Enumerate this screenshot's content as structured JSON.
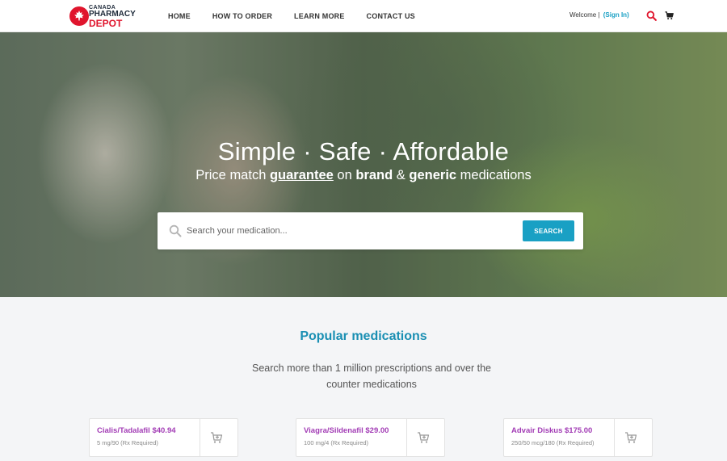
{
  "header": {
    "logo": {
      "line1": "CANADA",
      "line2": "PHARMACY",
      "line3": "DEPOT"
    },
    "nav": [
      {
        "label": "HOME"
      },
      {
        "label": "HOW TO ORDER"
      },
      {
        "label": "LEARN MORE"
      },
      {
        "label": "CONTACT US"
      }
    ],
    "welcome": "Welcome |",
    "signin": "(Sign In)",
    "icons": [
      "search-icon",
      "cart-icon"
    ]
  },
  "hero": {
    "title": "Simple · Safe · Affordable",
    "sub_prefix": "Price match ",
    "sub_guarantee": "guarantee",
    "sub_on": " on ",
    "sub_brand": "brand",
    "sub_amp": " & ",
    "sub_generic": "generic",
    "sub_suffix": " medications",
    "search_placeholder": "Search your medication...",
    "search_button": "SEARCH"
  },
  "popular": {
    "title": "Popular medications",
    "description": "Search more than 1 million prescriptions and over the counter medications",
    "items": [
      {
        "name": "Cialis/Tadalafil $40.94",
        "detail": "5 mg/90 (Rx Required)"
      },
      {
        "name": "Viagra/Sildenafil $29.00",
        "detail": "100 mg/4 (Rx Required)"
      },
      {
        "name": "Advair Diskus $175.00",
        "detail": "250/50 mcg/180 (Rx Required)"
      }
    ]
  },
  "colors": {
    "brand_red": "#e0152d",
    "accent_blue": "#19a0c4",
    "med_purple": "#a23cb5"
  }
}
